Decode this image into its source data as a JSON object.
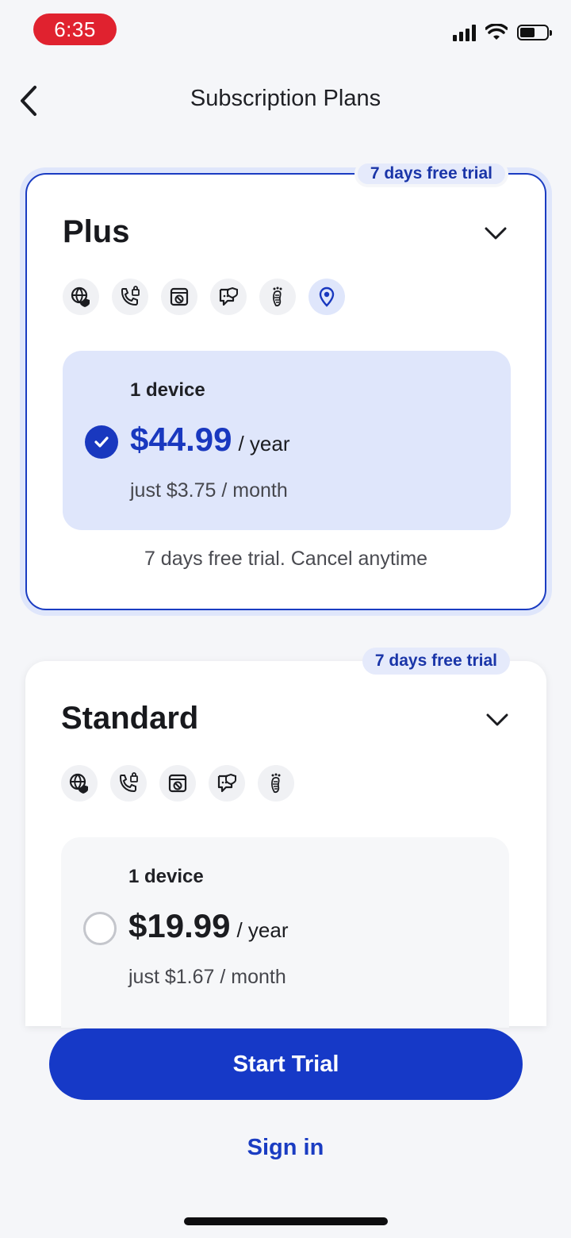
{
  "status_bar": {
    "time": "6:35"
  },
  "header": {
    "title": "Subscription Plans"
  },
  "plans": [
    {
      "badge": "7 days free trial",
      "name": "Plus",
      "device": "1 device",
      "price": "$44.99",
      "period": "/ year",
      "monthly": "just $3.75 / month",
      "note": "7 days free trial. Cancel anytime",
      "selected": true
    },
    {
      "badge": "7 days free trial",
      "name": "Standard",
      "device": "1 device",
      "price": "$19.99",
      "period": "/ year",
      "monthly": "just $1.67 / month",
      "selected": false
    }
  ],
  "actions": {
    "start": "Start Trial",
    "signin": "Sign in"
  },
  "colors": {
    "accent": "#1639c7",
    "accent_light": "#dfe6fb",
    "status_red": "#e0222f"
  }
}
